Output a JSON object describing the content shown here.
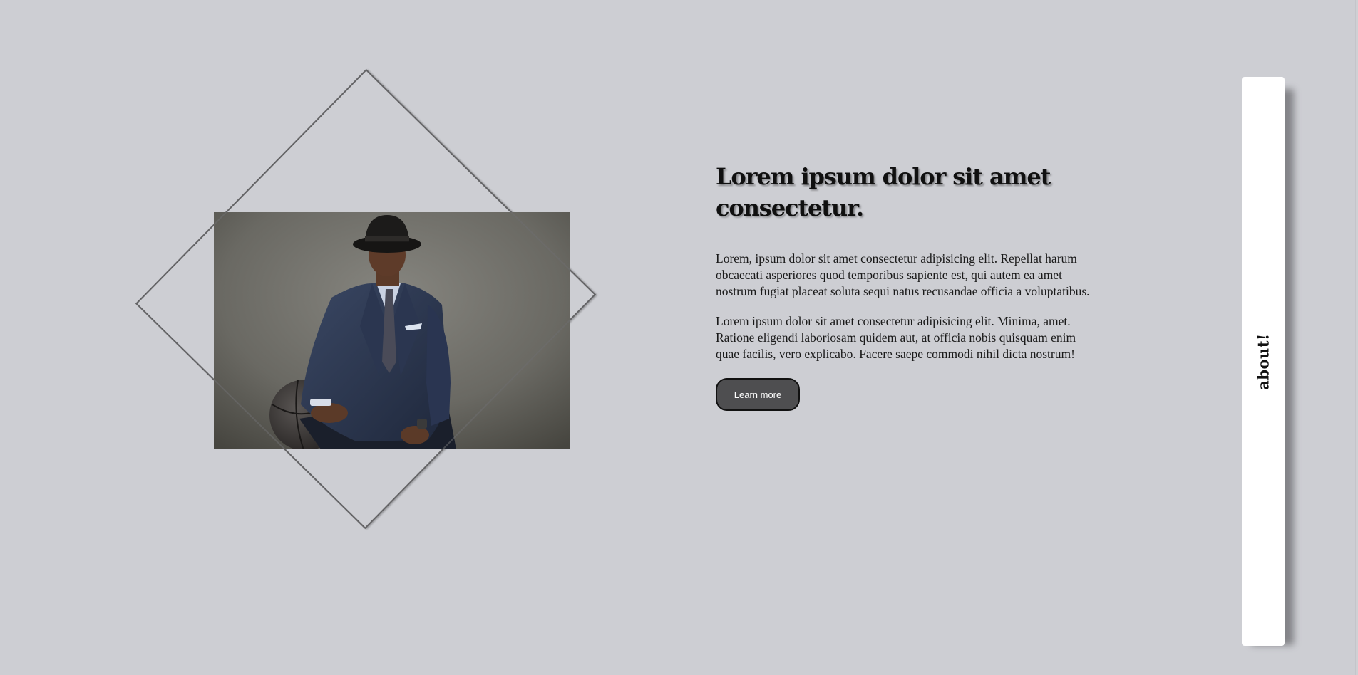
{
  "hero": {
    "image": {
      "alt": "Portrait photo of a man in a navy suit and black fedora holding a basketball",
      "icon": "portrait-photo"
    },
    "heading": "Lorem ipsum dolor sit amet consectetur.",
    "paragraphs": [
      "Lorem, ipsum dolor sit amet consectetur adipisicing elit. Repellat harum obcaecati asperiores quod temporibus sapiente est, qui autem ea amet nostrum fugiat placeat soluta sequi natus recusandae officia a voluptatibus.",
      "Lorem ipsum dolor sit amet consectetur adipisicing elit. Minima, amet. Ratione eligendi laboriosam quidem aut, at officia nobis quisquam enim quae facilis, vero explicabo. Facere saepe commodi nihil dicta nostrum!"
    ],
    "button_label": "Learn more"
  },
  "side_tab": {
    "label": "about!"
  },
  "colors": {
    "background": "#cdced3",
    "button_bg": "#4e4e50",
    "panel_bg": "#ffffff",
    "outline": "#5a5a5c"
  }
}
